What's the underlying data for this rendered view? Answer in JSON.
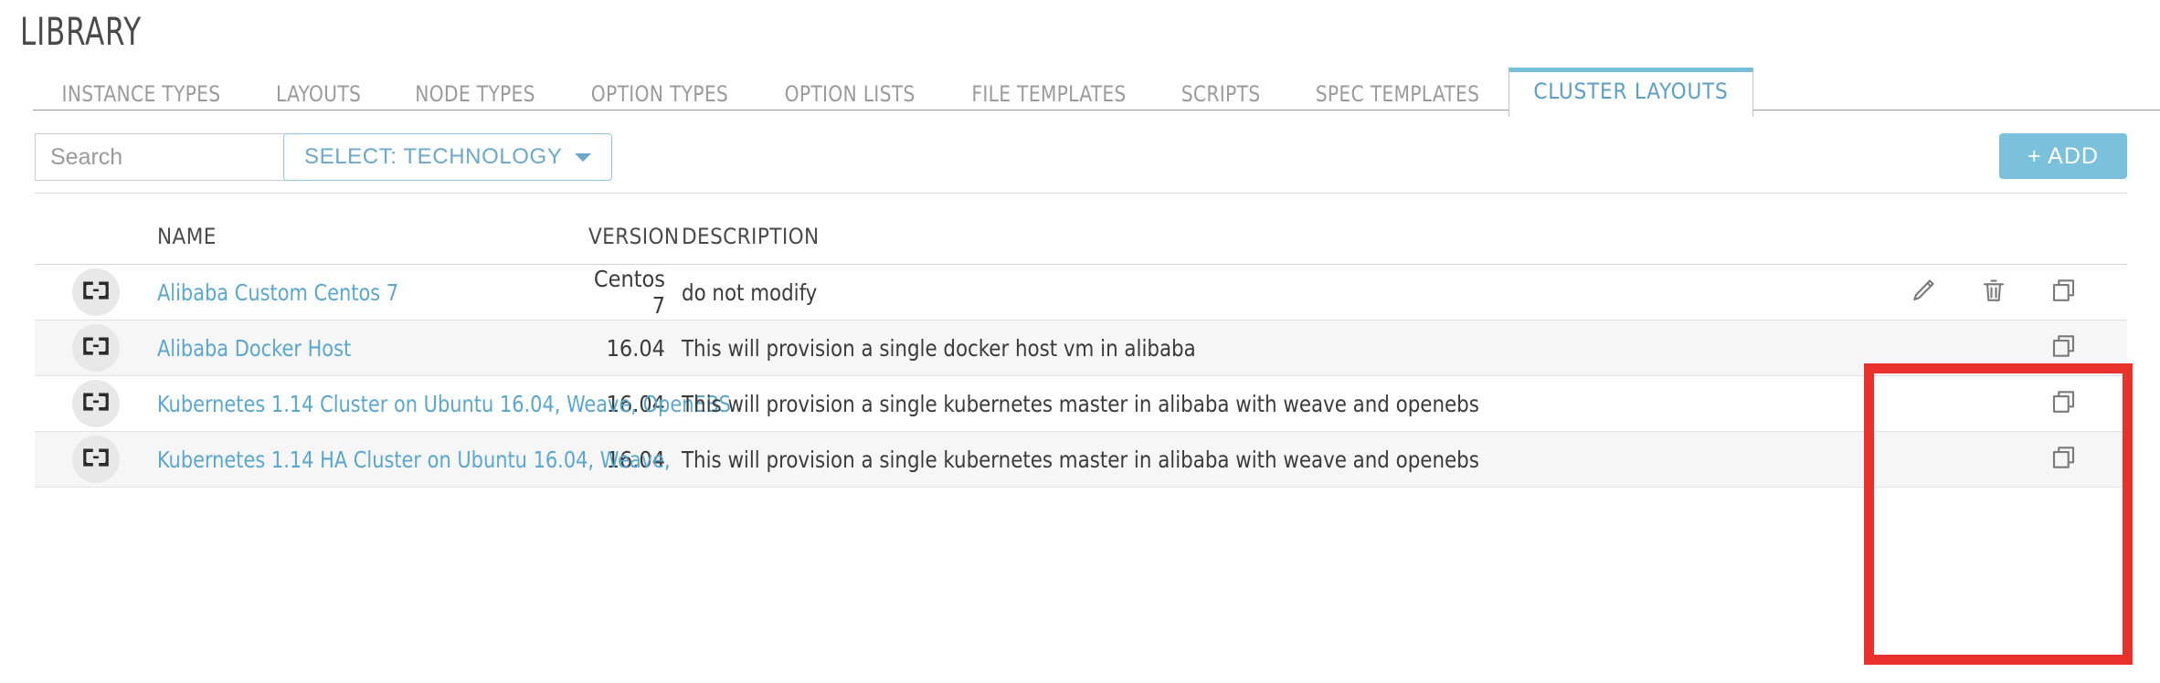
{
  "header": {
    "title": "LIBRARY"
  },
  "tabs": [
    {
      "label": "INSTANCE TYPES",
      "active": false
    },
    {
      "label": "LAYOUTS",
      "active": false
    },
    {
      "label": "NODE TYPES",
      "active": false
    },
    {
      "label": "OPTION TYPES",
      "active": false
    },
    {
      "label": "OPTION LISTS",
      "active": false
    },
    {
      "label": "FILE TEMPLATES",
      "active": false
    },
    {
      "label": "SCRIPTS",
      "active": false
    },
    {
      "label": "SPEC TEMPLATES",
      "active": false
    },
    {
      "label": "CLUSTER LAYOUTS",
      "active": true
    }
  ],
  "toolbar": {
    "search_value": "",
    "search_placeholder": "Search",
    "search_icon": "search-icon",
    "select_label": "SELECT: TECHNOLOGY",
    "select_caret_icon": "chevron-down-icon",
    "add_label": "+ ADD"
  },
  "table": {
    "columns": [
      "NAME",
      "VERSION",
      "DESCRIPTION"
    ],
    "rows": [
      {
        "icon": "cluster-icon",
        "name": "Alibaba Custom Centos 7",
        "version": "Centos 7",
        "description": "do not modify",
        "actions": [
          "edit-icon",
          "delete-icon",
          "duplicate-icon"
        ]
      },
      {
        "icon": "cluster-icon",
        "name": "Alibaba Docker Host",
        "version": "16.04",
        "description": "This will provision a single docker host vm in alibaba",
        "actions": [
          "duplicate-icon"
        ]
      },
      {
        "icon": "cluster-icon",
        "name": "Kubernetes 1.14 Cluster on Ubuntu 16.04, Weave, OpenEBS",
        "version": "16.04",
        "description": "This will provision a single kubernetes master in alibaba with weave and openebs",
        "actions": [
          "duplicate-icon"
        ]
      },
      {
        "icon": "cluster-icon",
        "name": "Kubernetes 1.14 HA Cluster on Ubuntu 16.04, Weave,",
        "version": "16.04",
        "description": "This will provision a single kubernetes master in alibaba with weave and openebs",
        "actions": [
          "duplicate-icon"
        ]
      }
    ]
  },
  "annotation": {
    "name": "red-highlight-box",
    "color": "#e8312a"
  },
  "colors": {
    "accent": "#7cc1dc",
    "link": "#5aa7cf",
    "tab_active_text": "#5a9fc4",
    "tab_inactive_text": "#9b9b9b",
    "text": "#3b3b3b"
  }
}
